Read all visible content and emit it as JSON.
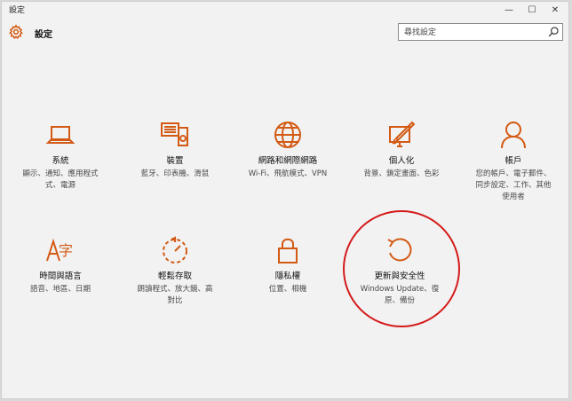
{
  "window": {
    "title": "設定",
    "minimize_glyph": "—",
    "maximize_glyph": "☐",
    "close_glyph": "✕"
  },
  "header": {
    "app_name": "設定",
    "icon": "gear-icon"
  },
  "search": {
    "placeholder": "尋找設定",
    "value": "",
    "icon": "search-icon"
  },
  "tiles": [
    {
      "name": "系統",
      "desc1": "顯示、通知、應用程式",
      "desc2": "式、電源",
      "icon": "laptop-icon"
    },
    {
      "name": "裝置",
      "desc1": "藍牙、印表機、滑鼠",
      "desc2": "",
      "icon": "keyboard-device-icon"
    },
    {
      "name": "網路和網際網路",
      "desc1": "Wi-Fi、飛航模式、VPN",
      "desc2": "",
      "icon": "globe-icon"
    },
    {
      "name": "個人化",
      "desc1": "背景、鎖定畫面、色彩",
      "desc2": "",
      "icon": "paint-screen-icon"
    },
    {
      "name": "帳戶",
      "desc1": "您的帳戶、電子郵件、",
      "desc2": "同步設定、工作、其他",
      "desc3": "使用者",
      "icon": "person-icon"
    },
    {
      "name": "時間與語言",
      "desc1": "語音、地區、日期",
      "desc2": "",
      "icon": "language-icon"
    },
    {
      "name": "輕鬆存取",
      "desc1": "朗讀程式、放大鏡、高",
      "desc2": "對比",
      "icon": "ease-of-access-icon"
    },
    {
      "name": "隱私權",
      "desc1": "位置、相機",
      "desc2": "",
      "icon": "lock-icon"
    },
    {
      "name": "更新與安全性",
      "desc1": "Windows Update、復",
      "desc2": "原、備份",
      "icon": "update-refresh-icon"
    }
  ],
  "colors": {
    "accent": "#d35a14",
    "annotation": "#d41a1a",
    "background": "#f2f2f2"
  }
}
